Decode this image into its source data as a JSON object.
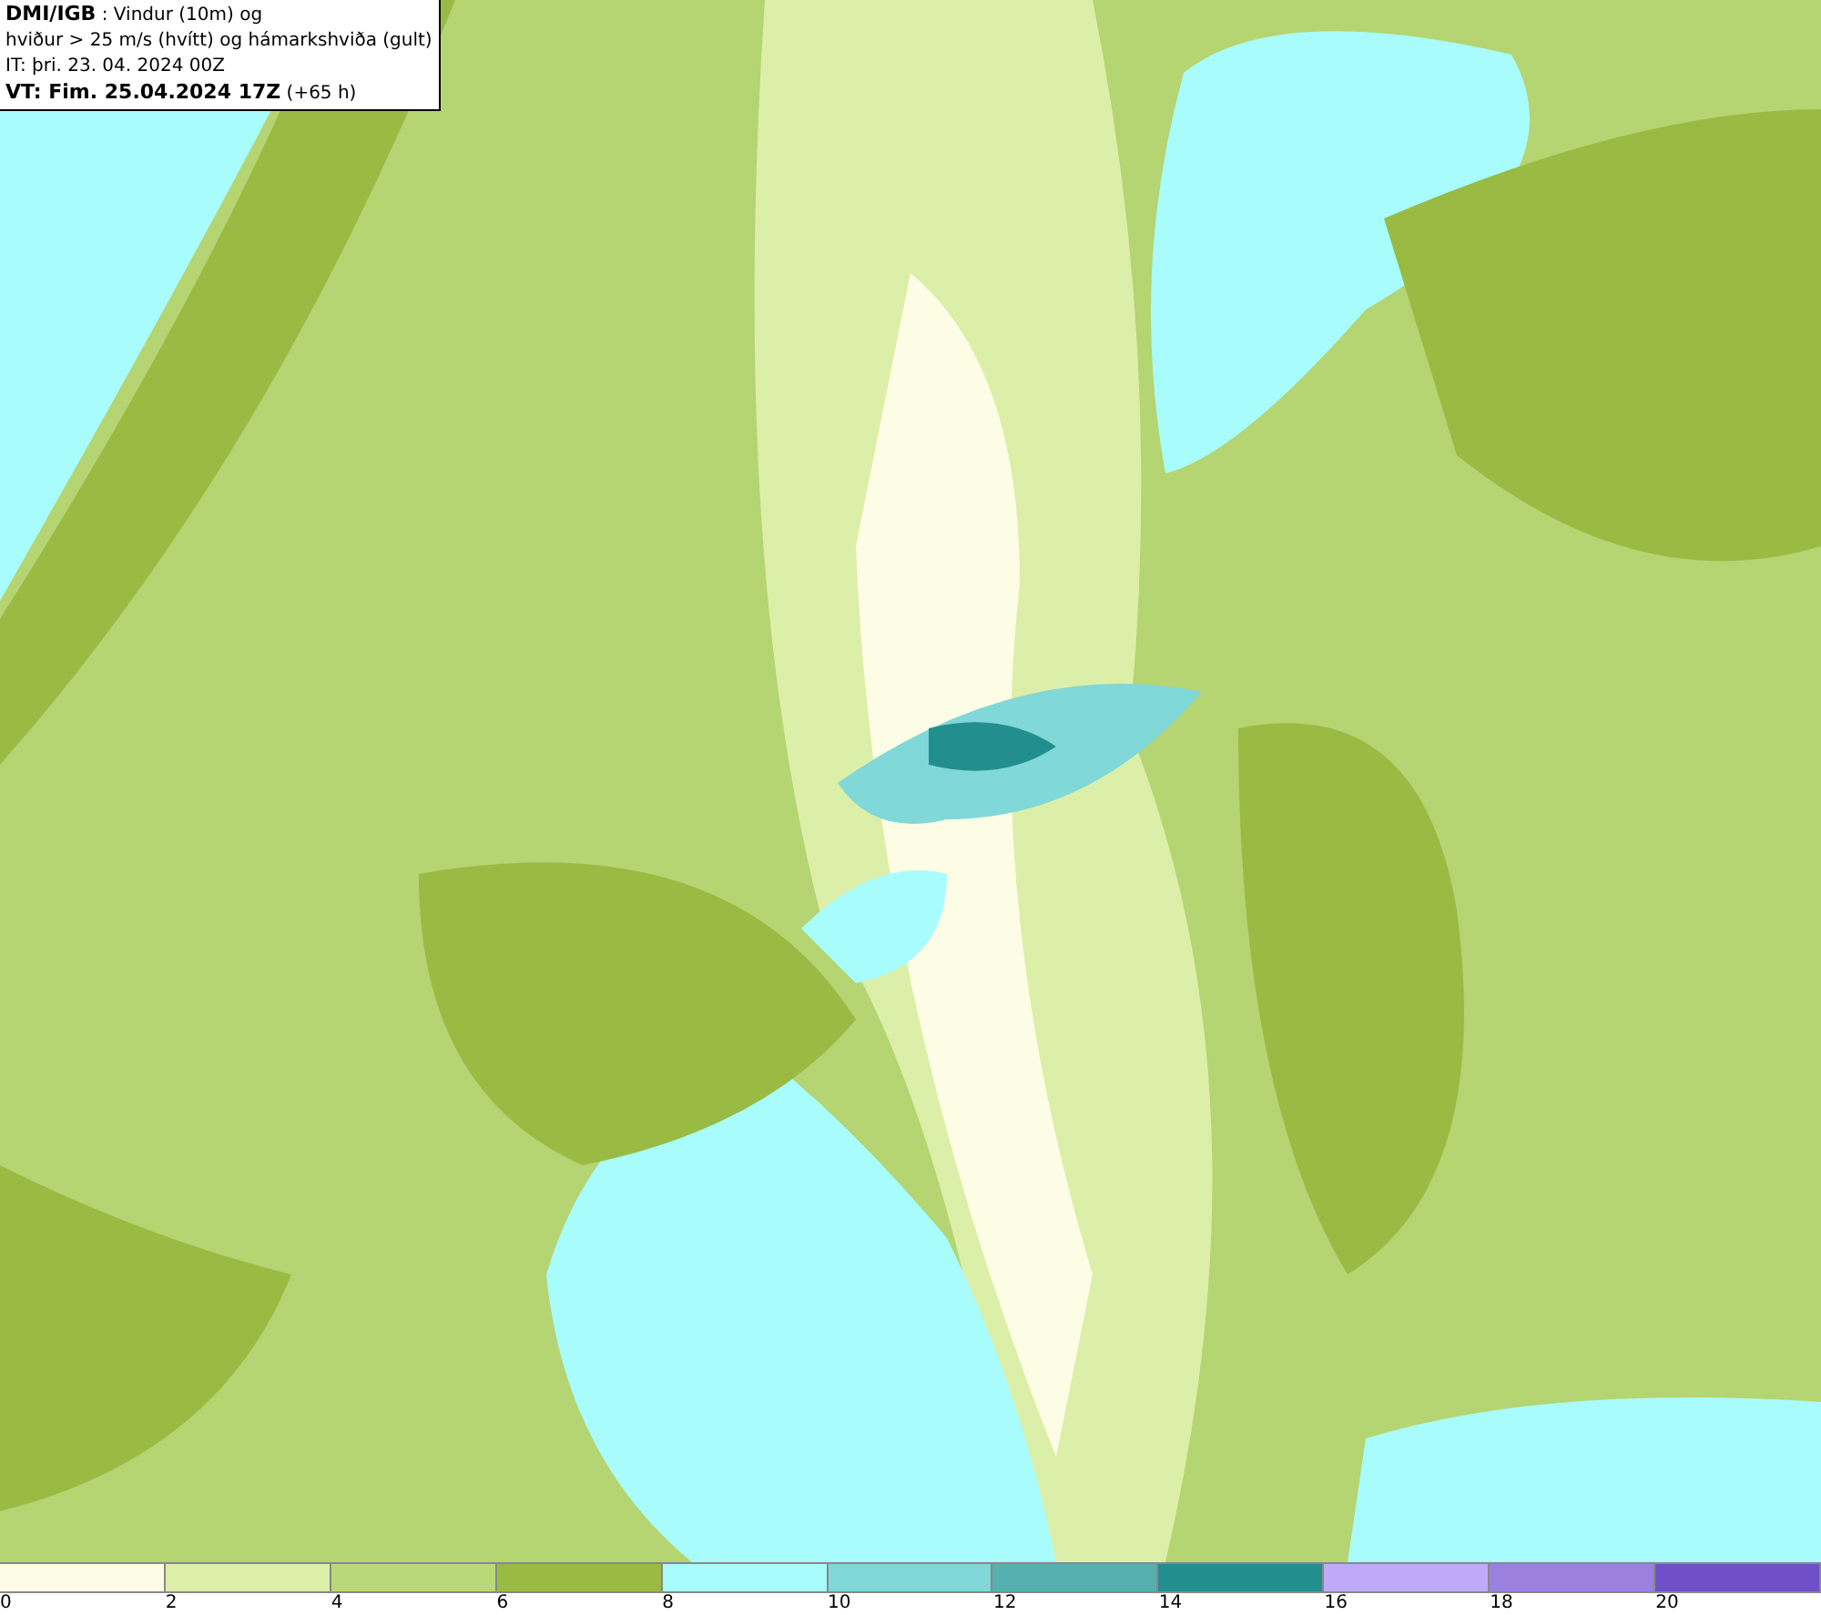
{
  "header": {
    "lines": [
      "**DMI/IGB** : Vindur (10m) og",
      "hviður > 25 m/s (hvítt) og hámarkshviða (gult)",
      "IT: þri. 23. 04. 2024 00Z",
      "**VT: Fim. 25.04.2024 17Z** (+65 h)"
    ]
  },
  "legend": [
    {
      "label": "0",
      "color": "#fdfde6"
    },
    {
      "label": "2",
      "color": "#dcefa8"
    },
    {
      "label": "4",
      "color": "#b9d978"
    },
    {
      "label": "6",
      "color": "#99bb44"
    },
    {
      "label": "8",
      "color": "#a8fcfc"
    },
    {
      "label": "10",
      "color": "#80d8d8"
    },
    {
      "label": "12",
      "color": "#55b0b0"
    },
    {
      "label": "14",
      "color": "#238e8e"
    },
    {
      "label": "16",
      "color": "#c0aaf8"
    },
    {
      "label": "18",
      "color": "#9b80e0"
    },
    {
      "label": "20",
      "color": "#7050c8"
    }
  ]
}
